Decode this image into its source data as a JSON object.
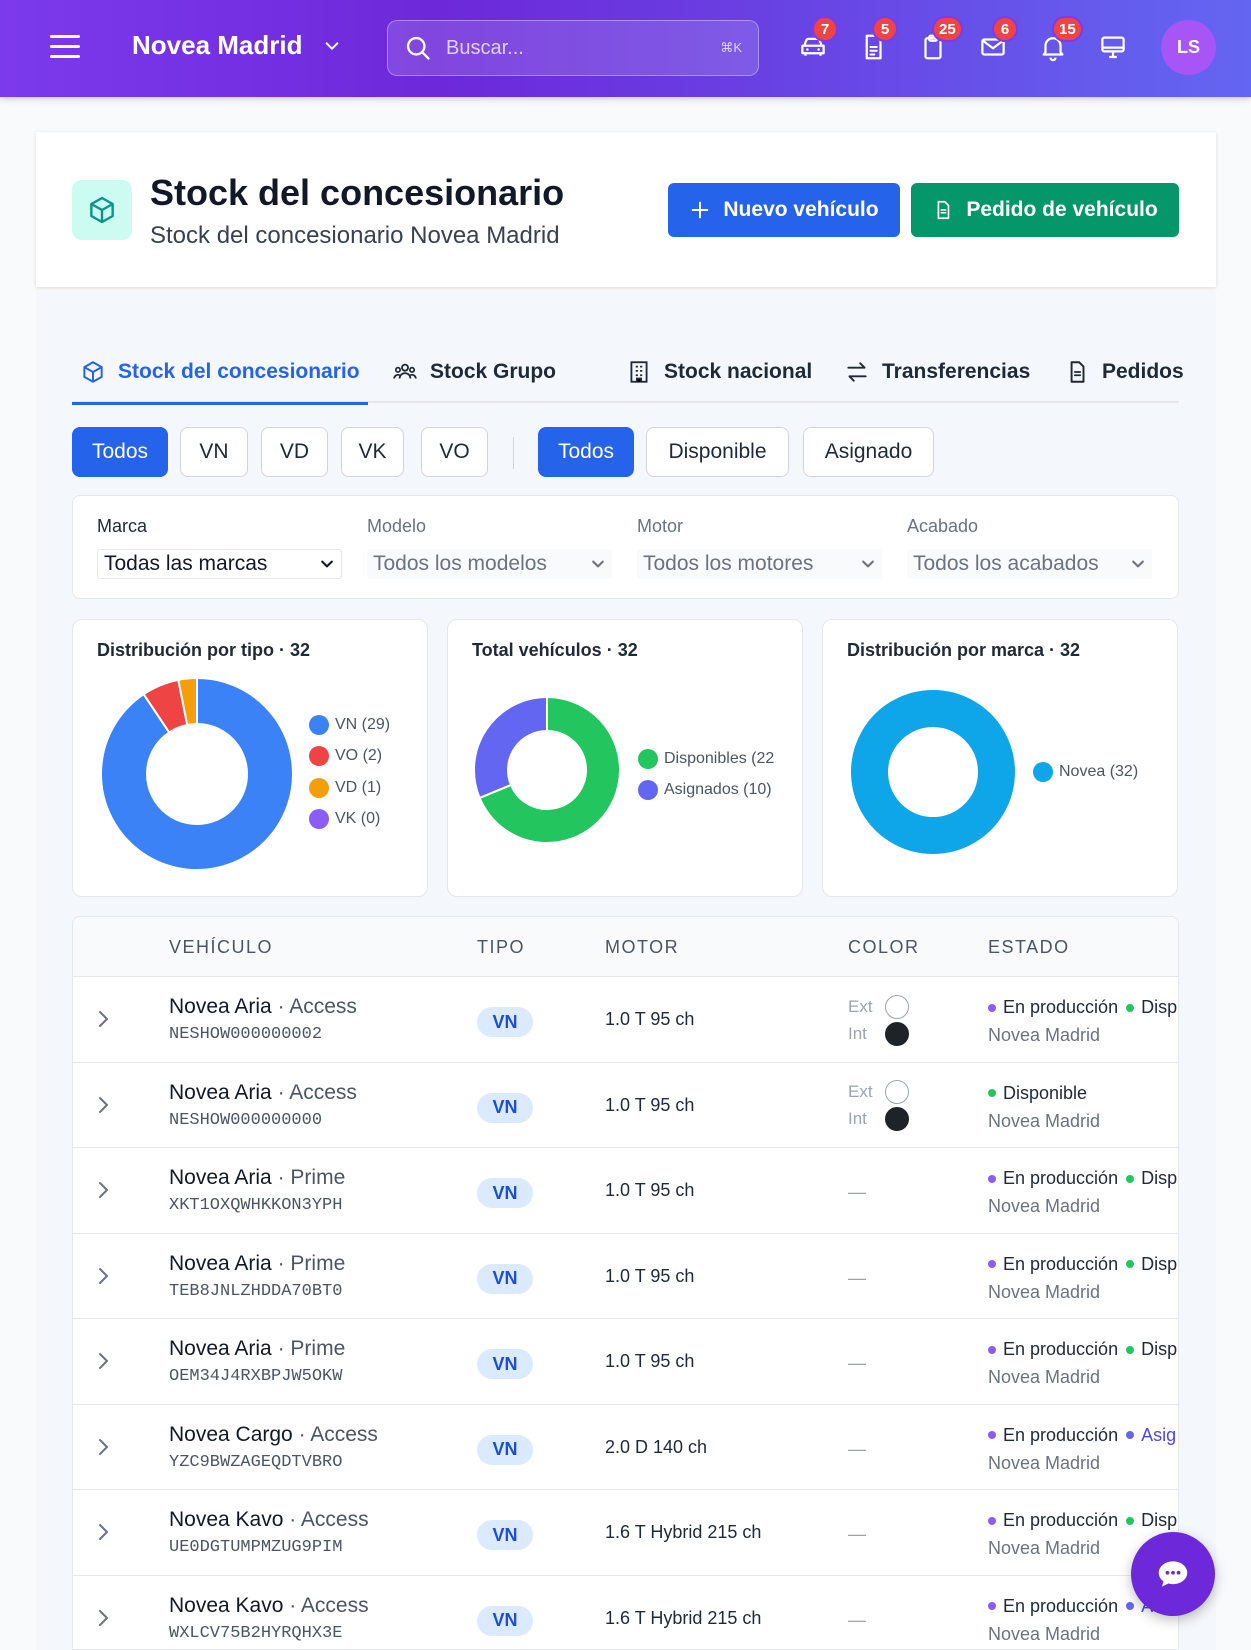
{
  "topbar": {
    "brand": "Novea Madrid",
    "search_placeholder": "Buscar...",
    "search_shortcut": "⌘K",
    "icons": [
      {
        "name": "car-icon",
        "badge": "7"
      },
      {
        "name": "document-icon",
        "badge": "5"
      },
      {
        "name": "clipboard-icon",
        "badge": "25"
      },
      {
        "name": "mail-icon",
        "badge": "6"
      },
      {
        "name": "bell-icon",
        "badge": "15"
      },
      {
        "name": "monitor-icon",
        "badge": ""
      }
    ],
    "avatar": "LS"
  },
  "header": {
    "title": "Stock del concesionario",
    "subtitle": "Stock del concesionario Novea Madrid",
    "new_vehicle": "Nuevo vehículo",
    "order_vehicle": "Pedido de vehículo"
  },
  "tabs": [
    "Stock del concesionario",
    "Stock Grupo",
    "Stock nacional",
    "Transferencias",
    "Pedidos"
  ],
  "type_filters": [
    "Todos",
    "VN",
    "VD",
    "VK",
    "VO"
  ],
  "status_filters": [
    "Todos",
    "Disponible",
    "Asignado"
  ],
  "filters": {
    "marca": {
      "label": "Marca",
      "value": "Todas las marcas"
    },
    "modelo": {
      "label": "Modelo",
      "value": "Todos los modelos"
    },
    "motor": {
      "label": "Motor",
      "value": "Todos los motores"
    },
    "acabado": {
      "label": "Acabado",
      "value": "Todos los acabados"
    }
  },
  "colors": {
    "vn": "#3b82f6",
    "vo": "#ef4444",
    "vd": "#f59e0b",
    "vk": "#8b5cf6",
    "disponibles": "#22c55e",
    "asignados": "#6366f1",
    "novea": "#0ea5e9"
  },
  "chart_data": [
    {
      "type": "pie",
      "title": "Distribución por tipo · 32",
      "labels": [
        "VN (29)",
        "VO (2)",
        "VD (1)",
        "VK (0)"
      ],
      "values": [
        29,
        2,
        1,
        0
      ]
    },
    {
      "type": "pie",
      "title": "Total vehículos · 32",
      "labels": [
        "Disponibles (22",
        "Asignados (10)"
      ],
      "values": [
        22,
        10
      ]
    },
    {
      "type": "pie",
      "title": "Distribución por marca · 32",
      "labels": [
        "Novea (32)"
      ],
      "values": [
        32
      ]
    }
  ],
  "table": {
    "headers": [
      "VEHÍCULO",
      "TIPO",
      "MOTOR",
      "COLOR",
      "ESTADO"
    ],
    "color_ext": "Ext",
    "color_int": "Int",
    "rows": [
      {
        "model": "Novea Aria",
        "sep": " · ",
        "trim": "Access",
        "vin": "NESHOW000000002",
        "tipo": "VN",
        "motor": "1.0 T 95 ch",
        "color": true,
        "estado1": "En producción",
        "estado2": "Disp",
        "estado2_class": "disp",
        "location": "Novea Madrid"
      },
      {
        "model": "Novea Aria",
        "sep": " · ",
        "trim": "Access",
        "vin": "NESHOW000000000",
        "tipo": "VN",
        "motor": "1.0 T 95 ch",
        "color": true,
        "estado1": "",
        "estado2": "Disponible",
        "estado2_class": "disp",
        "location": "Novea Madrid"
      },
      {
        "model": "Novea Aria",
        "sep": " · ",
        "trim": "Prime",
        "vin": "XKT1OXQWHKKON3YPH",
        "tipo": "VN",
        "motor": "1.0 T 95 ch",
        "color": false,
        "dash": "—",
        "estado1": "En producción",
        "estado2": "Disp",
        "estado2_class": "disp",
        "location": "Novea Madrid"
      },
      {
        "model": "Novea Aria",
        "sep": " · ",
        "trim": "Prime",
        "vin": "TEB8JNLZHDDA70BT0",
        "tipo": "VN",
        "motor": "1.0 T 95 ch",
        "color": false,
        "dash": "—",
        "estado1": "En producción",
        "estado2": "Disp",
        "estado2_class": "disp",
        "location": "Novea Madrid"
      },
      {
        "model": "Novea Aria",
        "sep": " · ",
        "trim": "Prime",
        "vin": "OEM34J4RXBPJW5OKW",
        "tipo": "VN",
        "motor": "1.0 T 95 ch",
        "color": false,
        "dash": "—",
        "estado1": "En producción",
        "estado2": "Disp",
        "estado2_class": "disp",
        "location": "Novea Madrid"
      },
      {
        "model": "Novea Cargo",
        "sep": " · ",
        "trim": "Access",
        "vin": "YZC9BWZAGEQDTVBRO",
        "tipo": "VN",
        "motor": "2.0 D 140 ch",
        "color": false,
        "dash": "—",
        "estado1": "En producción",
        "estado2": "Asig",
        "estado2_class": "asig",
        "location": "Novea Madrid"
      },
      {
        "model": "Novea Kavo",
        "sep": " · ",
        "trim": "Access",
        "vin": "UE0DGTUMPMZUG9PIM",
        "tipo": "VN",
        "motor": "1.6 T Hybrid 215 ch",
        "color": false,
        "dash": "—",
        "estado1": "En producción",
        "estado2": "Disp",
        "estado2_class": "disp",
        "location": "Novea Madrid"
      },
      {
        "model": "Novea Kavo",
        "sep": " · ",
        "trim": "Access",
        "vin": "WXLCV75B2HYRQHX3E",
        "tipo": "VN",
        "motor": "1.6 T Hybrid 215 ch",
        "color": false,
        "dash": "—",
        "estado1": "En producción",
        "estado2": "Asig",
        "estado2_class": "asig",
        "location": "Novea Madrid"
      }
    ]
  }
}
